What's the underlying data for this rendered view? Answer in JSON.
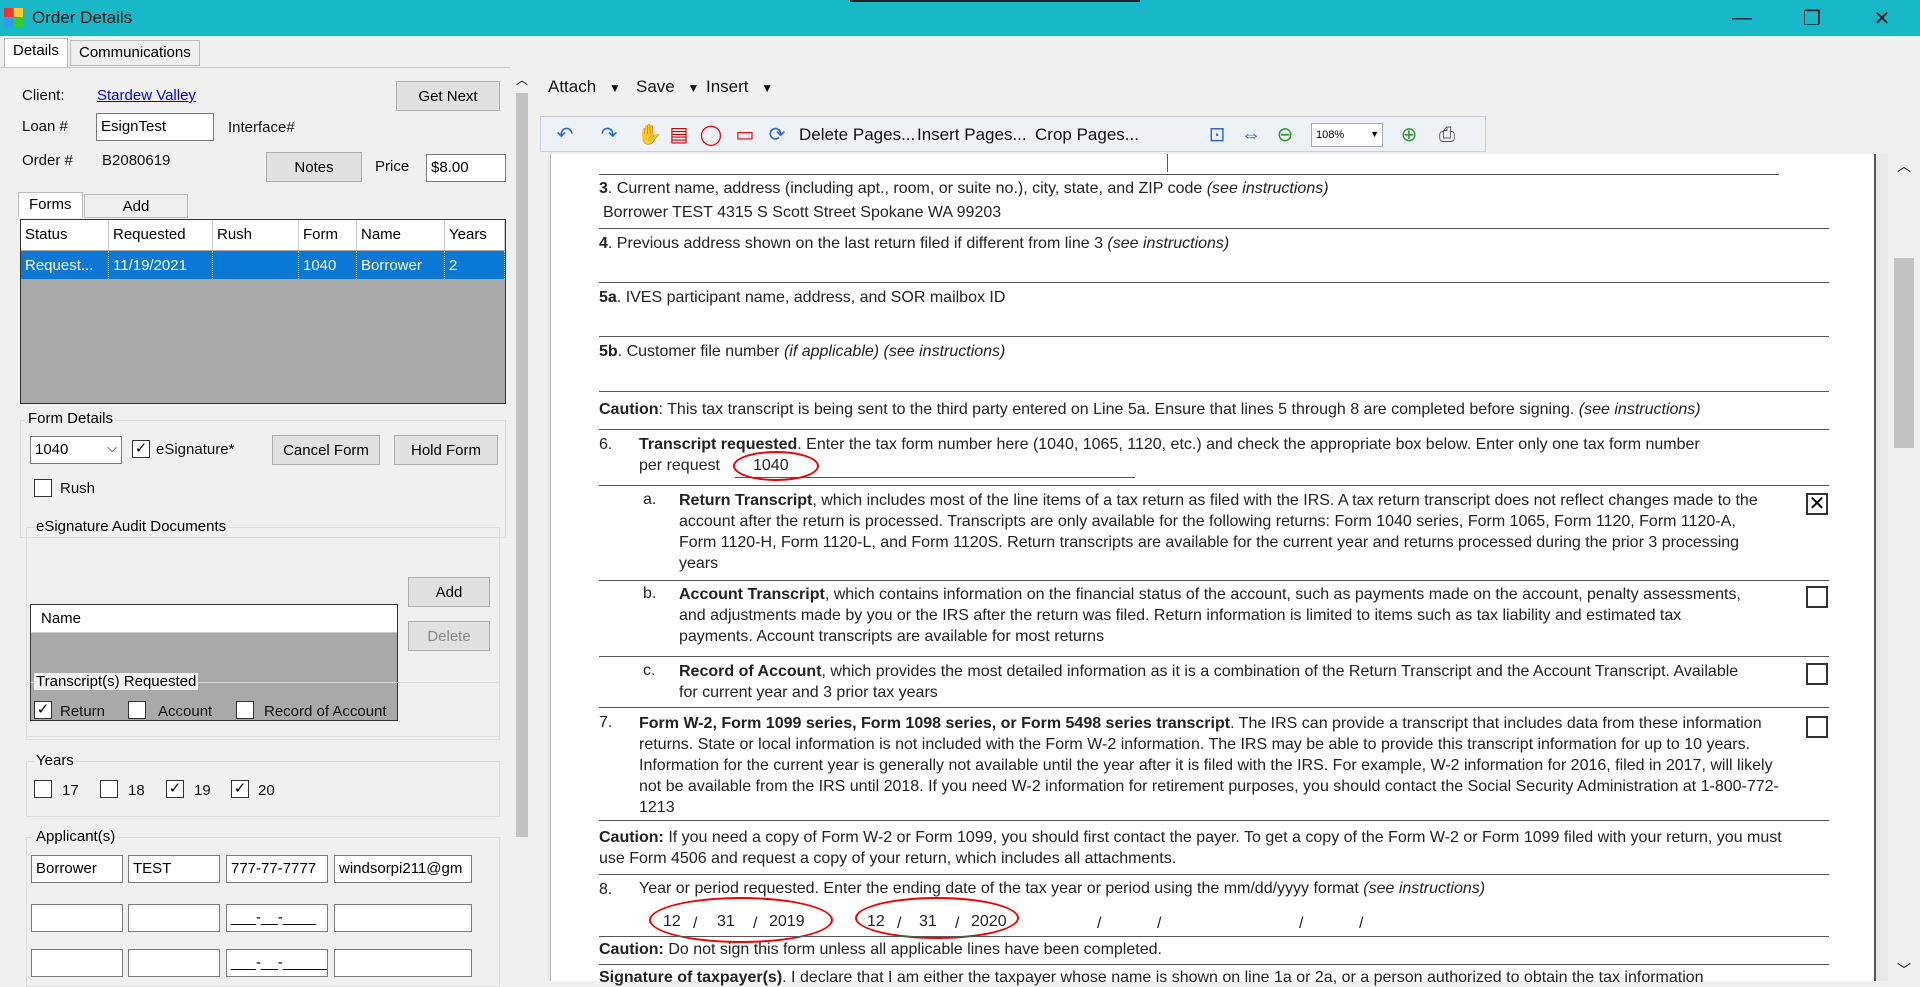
{
  "window": {
    "title": "Order Details",
    "minimize": "—",
    "restore": "❐",
    "close": "✕"
  },
  "tabs": [
    {
      "label": "Details"
    },
    {
      "label": "Communications"
    }
  ],
  "order": {
    "client_label": "Client:",
    "client_value": "Stardew Valley",
    "get_next": "Get Next",
    "loan_label": "Loan #",
    "loan_value": "EsignTest",
    "interface_label": "Interface#",
    "order_label": "Order #",
    "order_value": "B2080619",
    "notes": "Notes",
    "price_label": "Price",
    "price_value": "$8.00"
  },
  "forms": {
    "tab_label": "Forms",
    "add_tab": "Add",
    "columns": [
      "Status",
      "Requested",
      "Rush",
      "Form",
      "Name",
      "Years"
    ],
    "rows": [
      {
        "status": "Request...",
        "requested": "11/19/2021",
        "rush": "",
        "form": "1040",
        "name": "Borrower",
        "years": "2"
      }
    ]
  },
  "form_details": {
    "title": "Form Details",
    "form_select": "1040",
    "esignature_label": "eSignature*",
    "esignature_checked": "✓",
    "cancel": "Cancel Form",
    "hold": "Hold Form",
    "rush_label": "Rush"
  },
  "audit": {
    "title": "eSignature Audit Documents",
    "col_name": "Name",
    "add": "Add",
    "delete": "Delete"
  },
  "transcripts": {
    "title": "Transcript(s) Requested",
    "items": [
      {
        "label": "Return",
        "mark": "✓"
      },
      {
        "label": "Account",
        "mark": ""
      },
      {
        "label": "Record of Account",
        "mark": ""
      }
    ]
  },
  "years": {
    "title": "Years",
    "items": [
      {
        "label": "17",
        "mark": ""
      },
      {
        "label": "18",
        "mark": ""
      },
      {
        "label": "19",
        "mark": "✓"
      },
      {
        "label": "20",
        "mark": "✓"
      }
    ]
  },
  "applicants": {
    "title": "Applicant(s)",
    "row1": [
      "Borrower",
      "TEST",
      "777-77-7777",
      "windsorpi211@gm"
    ],
    "ssn_mask": "___-__-____",
    "ssn_mask2": "___-__-______"
  },
  "viewer": {
    "menus": [
      "Attach",
      "Save",
      "Insert"
    ],
    "toolbar": {
      "delete_pages": "Delete Pages...",
      "insert_pages": "Insert Pages...",
      "crop_pages": "Crop Pages...",
      "zoom": "108%"
    }
  },
  "document": {
    "l3_num": "3",
    "l3_text": ". Current name, address (including apt., room, or suite no.), city, state, and ZIP code ",
    "l3_hint": "(see instructions)",
    "l3_value": "Borrower TEST 4315 S Scott Street Spokane WA 99203",
    "l4_num": "4",
    "l4_text": ". Previous address shown on the last return filed if different from line 3 ",
    "l4_hint": "(see instructions)",
    "l5a_num": "5a",
    "l5a_text": ". IVES participant name, address, and SOR mailbox ID",
    "l5b_num": "5b",
    "l5b_text": ". Customer file number ",
    "l5b_hint": "(if applicable) (see instructions)",
    "caution1_label": "Caution",
    "caution1_text": ": This tax transcript is being sent to the third party entered on Line 5a. Ensure that lines 5 through 8 are completed before signing. ",
    "caution1_hint": "(see instructions)",
    "l6_num": "6.",
    "l6_bold": "Transcript requested",
    "l6_text": ". Enter the tax form number here (1040, 1065, 1120, etc.) and check the appropriate box below. Enter only one tax form number",
    "l6_text2": "per request",
    "l6_form": "1040",
    "a_num": "a.",
    "a_bold": "Return Transcript",
    "a_text": ", which includes most of the line items of a tax return as filed with the IRS. A tax return transcript does not reflect changes made to the account after the return is processed. Transcripts are only available for the following returns: Form 1040 series, Form 1065, Form 1120, Form 1120-A, Form 1120-H, Form 1120-L, and Form 1120S. Return transcripts are available for the current year and returns processed during the prior 3 processing years",
    "a_mark": "✕",
    "b_num": "b.",
    "b_bold": "Account Transcript",
    "b_text": ", which contains information on the financial status of the account, such as payments made on the account, penalty assessments, and adjustments made by you or the IRS after the return was filed. Return information is limited to items such as tax liability and estimated tax payments. Account transcripts are available for most returns",
    "c_num": "c.",
    "c_bold": "Record of Account",
    "c_text": ", which provides the most detailed information as it is a combination of the Return Transcript and the Account Transcript. Available for current year and 3 prior tax years",
    "l7_num": "7.",
    "l7_bold": "Form W-2, Form 1099 series, Form 1098 series, or Form 5498 series transcript",
    "l7_text": ". The IRS can provide a transcript that includes data from these information returns. State or local information is not included with the Form W-2 information. The IRS may be able to provide this transcript information for up to 10 years. Information for the current year is generally not available until the year after it is filed with the IRS. For example, W-2 information for 2016, filed in 2017, will likely not be available from the IRS until 2018. If you need W-2 information for retirement purposes, you should contact the Social Security Administration at 1-800-772-1213",
    "caution2_label": "Caution:",
    "caution2_text": " If you need a copy of Form W-2 or Form 1099, you should first contact the payer. To get a copy of the Form W-2 or Form 1099 filed with your return, you must use Form 4506 and request a copy of your return, which includes all  attachments.",
    "l8_num": "8.",
    "l8_text": "Year or period requested. Enter the ending date of the tax year or period using the mm/dd/yyyy format ",
    "l8_hint": "(see instructions)",
    "date1": {
      "mm": "12",
      "dd": "31",
      "yyyy": "2019"
    },
    "date2": {
      "mm": "12",
      "dd": "31",
      "yyyy": "2020"
    },
    "slash": "/",
    "caution3_label": "Caution:",
    "caution3_text": " Do not sign this form unless all applicable lines have been completed.",
    "sig_bold": "Signature of taxpayer(s)",
    "sig_text": ". I declare that I am either the taxpayer whose name is shown on line 1a or 2a, or a person authorized to obtain the tax information"
  },
  "colors": {
    "titlebar": "#17b8c8",
    "selection": "#0a78d7",
    "annotation": "#e00000",
    "link": "#0000ee"
  }
}
